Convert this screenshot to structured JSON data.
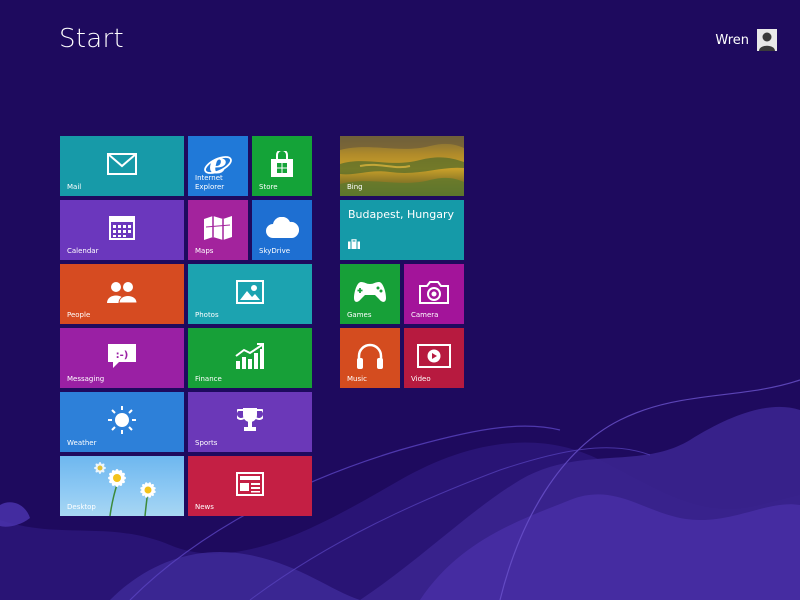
{
  "screen": {
    "title": "Start"
  },
  "user": {
    "name": "Wren",
    "icon": "user-avatar-icon"
  },
  "colors": {
    "background": "#1e0a5e",
    "swirl": "#3f2a9a",
    "mail": "#179aa8",
    "ie": "#2079d8",
    "store": "#14a338",
    "calendar": "#6b37bd",
    "maps": "#a3239d",
    "skydrive": "#1e6fd2",
    "people": "#d64b21",
    "photos": "#1ca3b0",
    "messaging": "#9a20a4",
    "finance": "#17a038",
    "weather": "#2d80d9",
    "sports": "#6b38b8",
    "news": "#c41f44",
    "bing_weather": "#159aa8",
    "games": "#17a038",
    "camera": "#a3149a",
    "music": "#d44c1f",
    "video": "#b71a3f"
  },
  "tiles": {
    "mail": {
      "label": "Mail",
      "icon": "mail-icon"
    },
    "ie": {
      "label": "Internet Explorer",
      "icon": "internet-explorer-icon"
    },
    "store": {
      "label": "Store",
      "icon": "store-icon"
    },
    "calendar": {
      "label": "Calendar",
      "icon": "calendar-icon"
    },
    "maps": {
      "label": "Maps",
      "icon": "maps-icon"
    },
    "skydrive": {
      "label": "SkyDrive",
      "icon": "cloud-icon"
    },
    "people": {
      "label": "People",
      "icon": "people-icon"
    },
    "photos": {
      "label": "Photos",
      "icon": "photos-icon"
    },
    "messaging": {
      "label": "Messaging",
      "icon": "messaging-icon"
    },
    "finance": {
      "label": "Finance",
      "icon": "finance-chart-icon"
    },
    "weather": {
      "label": "Weather",
      "icon": "sun-icon"
    },
    "sports": {
      "label": "Sports",
      "icon": "trophy-icon"
    },
    "desktop": {
      "label": "Desktop",
      "icon": "desktop-daisies-image"
    },
    "news": {
      "label": "News",
      "icon": "news-icon"
    },
    "bing": {
      "label": "Bing",
      "icon": "bing-landscape-image"
    },
    "travel": {
      "city": "Budapest, Hungary",
      "icon": "suitcase-icon"
    },
    "games": {
      "label": "Games",
      "icon": "xbox-controller-icon"
    },
    "camera": {
      "label": "Camera",
      "icon": "camera-icon"
    },
    "music": {
      "label": "Music",
      "icon": "headphones-icon"
    },
    "video": {
      "label": "Video",
      "icon": "video-play-icon"
    }
  }
}
